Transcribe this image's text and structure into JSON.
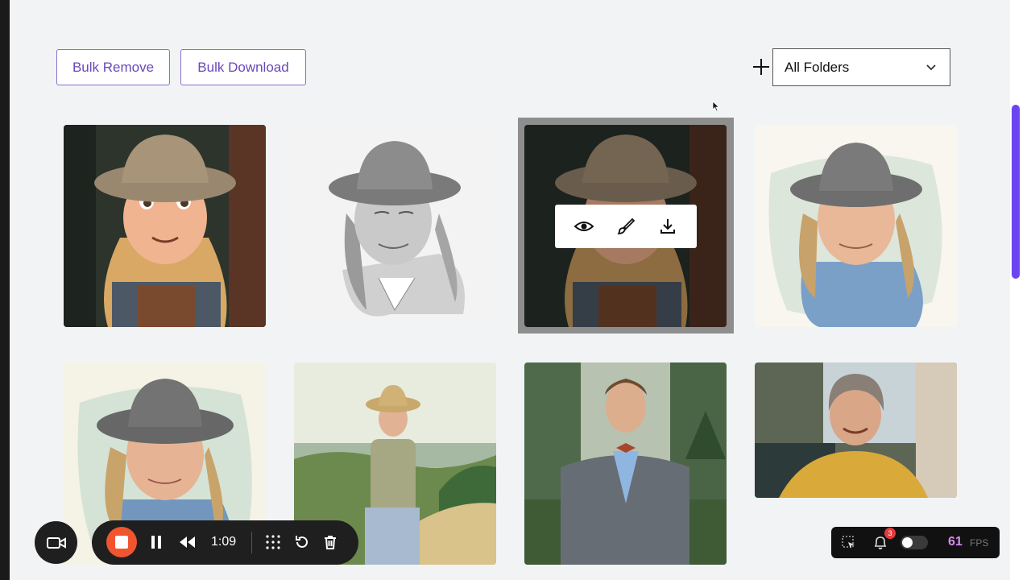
{
  "toolbar": {
    "bulk_remove_label": "Bulk Remove",
    "bulk_download_label": "Bulk Download",
    "add_icon": "plus-icon",
    "folder_select_value": "All Folders"
  },
  "gallery": {
    "images": [
      {
        "id": "tile-1",
        "style": "3d-cartoon",
        "description_icon": "image"
      },
      {
        "id": "tile-2",
        "style": "pencil-sketch"
      },
      {
        "id": "tile-3",
        "style": "3d-cartoon",
        "selected": true
      },
      {
        "id": "tile-4",
        "style": "watercolor"
      },
      {
        "id": "tile-5",
        "style": "watercolor"
      },
      {
        "id": "tile-6",
        "style": "painted-landscape"
      },
      {
        "id": "tile-7",
        "style": "photo-garden"
      },
      {
        "id": "tile-8",
        "style": "photo-indoor"
      }
    ],
    "overlay_actions": [
      "eye-icon",
      "brush-icon",
      "download-icon"
    ]
  },
  "recorder": {
    "time": "1:09"
  },
  "perf": {
    "notifications_count": "3",
    "fps_value": "61",
    "fps_label": "FPS"
  },
  "colors": {
    "accent": "#6a48b8",
    "scroll_thumb": "#6b46f0",
    "record_red": "#f0552f"
  }
}
